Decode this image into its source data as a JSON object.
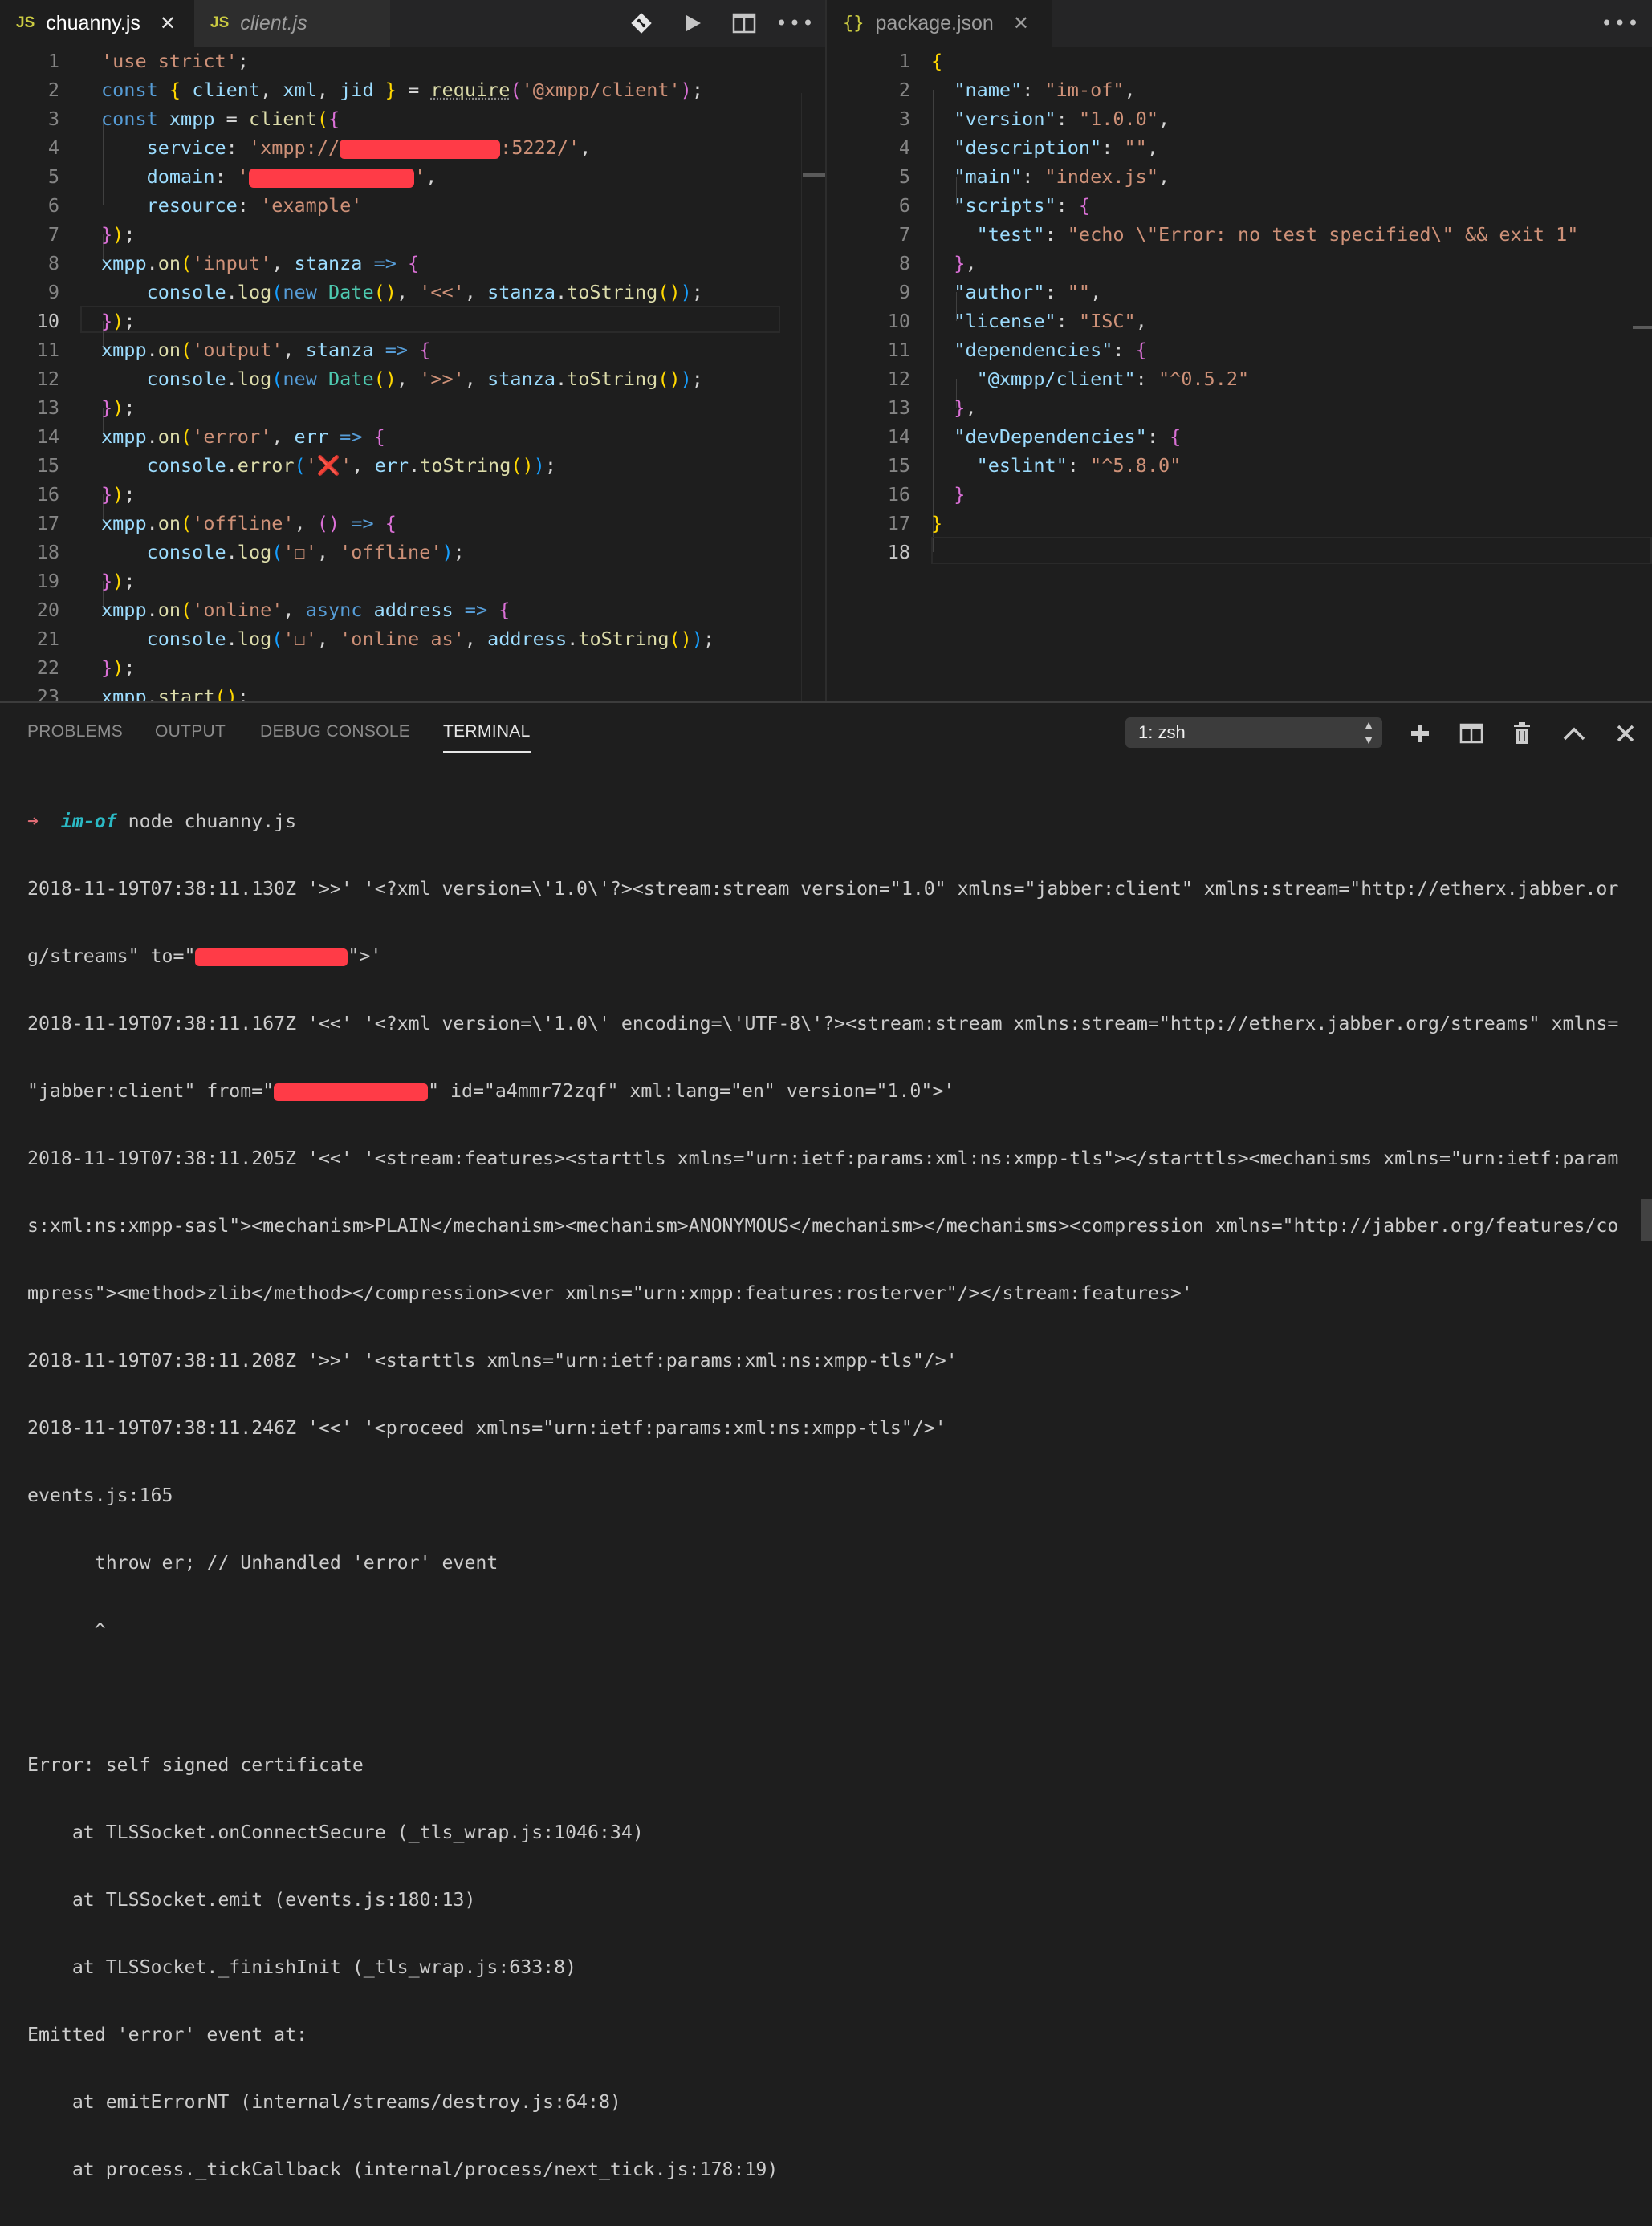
{
  "left_editor": {
    "tabs": [
      {
        "icon": "JS",
        "label": "chuanny.js",
        "active": true,
        "close": "✕"
      },
      {
        "icon": "JS",
        "label": "client.js",
        "active": false
      }
    ],
    "actions": [
      "git-compare-icon",
      "run-icon",
      "split-editor-icon",
      "more-icon"
    ],
    "current_line": "10",
    "line_numbers": [
      "1",
      "2",
      "3",
      "4",
      "5",
      "6",
      "7",
      "8",
      "9",
      "10",
      "11",
      "12",
      "13",
      "14",
      "15",
      "16",
      "17",
      "18",
      "19",
      "20",
      "21",
      "22",
      "23"
    ],
    "tokens": {
      "use_strict": "'use strict'",
      "semi": ";",
      "const": "const",
      "client": "client",
      "xml": "xml",
      "jid": "jid",
      "require": "require",
      "module": "'@xmpp/client'",
      "xmpp": "xmpp",
      "service_key": "service",
      "service_pre": "'xmpp://",
      "service_post": ":5222/'",
      "domain_key": "domain",
      "domain_pre": "'",
      "domain_post": "'",
      "resource_key": "resource",
      "resource_val": "'example'",
      "on": "on",
      "input": "'input'",
      "output": "'output'",
      "error": "'error'",
      "offline": "'offline'",
      "online": "'online'",
      "stanza": "stanza",
      "err": "err",
      "address": "address",
      "async": "async",
      "console": "console",
      "log": "log",
      "error_fn": "error",
      "new": "new",
      "Date": "Date",
      "lt": "'<<'",
      "gt": "'>>'",
      "toString": "toString",
      "cross": "'❌'",
      "box": "'☐'",
      "online_as": "'online as'",
      "start": "start",
      "arrow": "=>",
      "eq": "="
    }
  },
  "right_editor": {
    "tabs": [
      {
        "icon": "{}",
        "label": "package.json",
        "active": true,
        "close": "✕"
      }
    ],
    "actions": [
      "more-icon"
    ],
    "line_numbers": [
      "1",
      "2",
      "3",
      "4",
      "5",
      "6",
      "7",
      "8",
      "9",
      "10",
      "11",
      "12",
      "13",
      "14",
      "15",
      "16",
      "17",
      "18"
    ],
    "keys": {
      "name": "\"name\"",
      "version": "\"version\"",
      "description": "\"description\"",
      "main": "\"main\"",
      "scripts": "\"scripts\"",
      "test": "\"test\"",
      "author": "\"author\"",
      "license": "\"license\"",
      "dependencies": "\"dependencies\"",
      "xmpp_client": "\"@xmpp/client\"",
      "devDependencies": "\"devDependencies\"",
      "eslint": "\"eslint\""
    },
    "values": {
      "name": "\"im-of\"",
      "version": "\"1.0.0\"",
      "description": "\"\"",
      "main": "\"index.js\"",
      "test": "\"echo \\\"Error: no test specified\\\" && exit 1\"",
      "author": "\"\"",
      "license": "\"ISC\"",
      "xmpp_client": "\"^0.5.2\"",
      "eslint": "\"^5.8.0\""
    }
  },
  "panel": {
    "tabs": [
      "PROBLEMS",
      "OUTPUT",
      "DEBUG CONSOLE",
      "TERMINAL"
    ],
    "active_tab": "TERMINAL",
    "terminal_select": "1: zsh",
    "actions": [
      "plus-icon",
      "split-terminal-icon",
      "trash-icon",
      "chevron-up-icon",
      "close-icon"
    ]
  },
  "terminal": {
    "prompt_arrow": "➜",
    "prompt_dir": "im-of",
    "prompt_cmd": " node chuanny.js",
    "l1": "2018-11-19T07:38:11.130Z '>>' '<?xml version=\\'1.0\\'?><stream:stream version=\"1.0\" xmlns=\"jabber:client\" xmlns:stream=\"http://etherx.jabber.or",
    "l2_pre": "g/streams\" to=\"",
    "l2_post": "\">'",
    "l3": "2018-11-19T07:38:11.167Z '<<' '<?xml version=\\'1.0\\' encoding=\\'UTF-8\\'?><stream:stream xmlns:stream=\"http://etherx.jabber.org/streams\" xmlns=",
    "l4_pre": "\"jabber:client\" from=\"",
    "l4_post": "\" id=\"a4mmr72zqf\" xml:lang=\"en\" version=\"1.0\">'",
    "l5": "2018-11-19T07:38:11.205Z '<<' '<stream:features><starttls xmlns=\"urn:ietf:params:xml:ns:xmpp-tls\"></starttls><mechanisms xmlns=\"urn:ietf:param",
    "l6": "s:xml:ns:xmpp-sasl\"><mechanism>PLAIN</mechanism><mechanism>ANONYMOUS</mechanism></mechanisms><compression xmlns=\"http://jabber.org/features/co",
    "l7": "mpress\"><method>zlib</method></compression><ver xmlns=\"urn:xmpp:features:rosterver\"/></stream:features>'",
    "l8": "2018-11-19T07:38:11.208Z '>>' '<starttls xmlns=\"urn:ietf:params:xml:ns:xmpp-tls\"/>'",
    "l9": "2018-11-19T07:38:11.246Z '<<' '<proceed xmlns=\"urn:ietf:params:xml:ns:xmpp-tls\"/>'",
    "l10": "events.js:165",
    "l11": "      throw er; // Unhandled 'error' event",
    "l12": "      ^",
    "l13": "",
    "l14": "Error: self signed certificate",
    "l15": "    at TLSSocket.onConnectSecure (_tls_wrap.js:1046:34)",
    "l16": "    at TLSSocket.emit (events.js:180:13)",
    "l17": "    at TLSSocket._finishInit (_tls_wrap.js:633:8)",
    "l18": "Emitted 'error' event at:",
    "l19": "    at emitErrorNT (internal/streams/destroy.js:64:8)",
    "l20": "    at process._tickCallback (internal/process/next_tick.js:178:19)"
  },
  "colors": {
    "background": "#1e1e1e",
    "redaction": "#ff3b47",
    "string": "#ce9178",
    "keyword": "#569cd6",
    "function": "#dcdcaa"
  }
}
